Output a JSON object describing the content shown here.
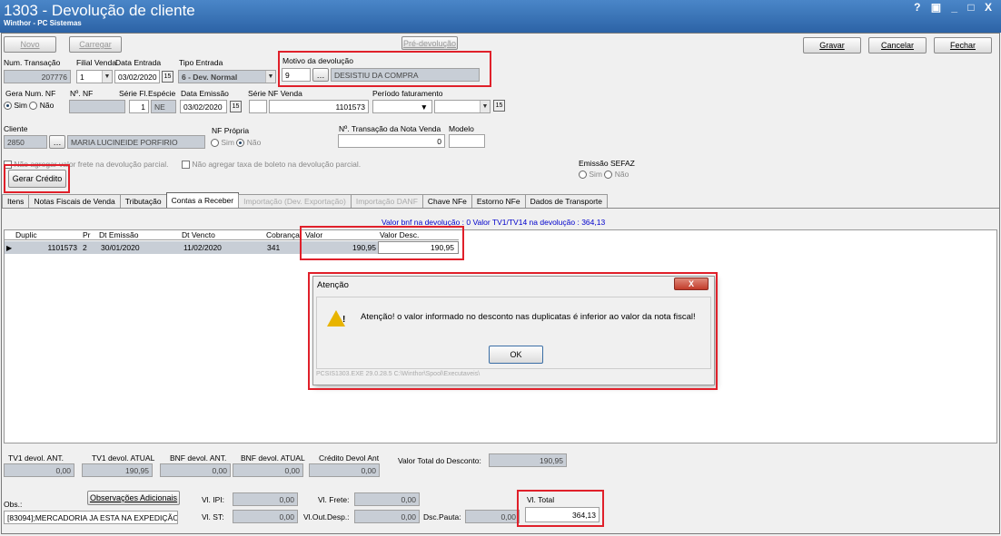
{
  "window": {
    "title": "1303 - Devolução de cliente",
    "subtitle": "Winthor - PC Sistemas",
    "controls": "? ▣ _ □ X"
  },
  "toolbar": {
    "novo": "Novo",
    "carregar": "Carregar",
    "pre_devolucao": "Pré-devolução",
    "gravar": "Gravar",
    "cancelar": "Cancelar",
    "fechar": "Fechar"
  },
  "header": {
    "num_transacao_label": "Num. Transação",
    "num_transacao": "207776",
    "filial_venda_label": "Filial Venda",
    "filial_venda": "1",
    "data_entrada_label": "Data Entrada",
    "data_entrada": "03/02/2020",
    "tipo_entrada_label": "Tipo Entrada",
    "tipo_entrada": "6 - Dev. Normal",
    "motivo_label": "Motivo da devolução",
    "motivo_codigo": "9",
    "motivo_desc": "DESISTIU DA COMPRA",
    "gera_num_nf_label": "Gera Num. NF",
    "sim": "Sim",
    "nao": "Não",
    "num_nf_label": "Nº. NF",
    "serie_fl_label": "Série Fl.",
    "serie_fl": "1",
    "especie_label": "Espécie",
    "especie": "NE",
    "data_emissao_label": "Data Emissão",
    "data_emissao": "03/02/2020",
    "serie_label": "Série",
    "nf_venda_label": "NF Venda",
    "nf_venda": "1101573",
    "periodo_label": "Período faturamento",
    "cliente_label": "Cliente",
    "cliente_codigo": "2850",
    "cliente_nome": "MARIA LUCINEIDE PORFIRIO",
    "nf_propria_label": "NF Própria",
    "num_transacao_nota_label": "Nº. Transação da Nota Venda",
    "num_transacao_nota": "0",
    "modelo_label": "Modelo",
    "frete_text": "Não agregar valor frete na devolução parcial.",
    "boleto_text": "Não agregar taxa de boleto na devolução parcial.",
    "sefaz_label": "Emissão SEFAZ",
    "gerar_credito": "Gerar Crédito"
  },
  "tabs": [
    "Itens",
    "Notas Fiscais de Venda",
    "Tributação",
    "Contas a Receber",
    "Importação (Dev. Exportação)",
    "Importação DANF",
    "Chave NFe",
    "Estorno NFe",
    "Dados de Transporte"
  ],
  "grid": {
    "info": "Valor bnf na devolução :  0  Valor TV1/TV14 na devolução :  364,13",
    "headers": {
      "duplic": "Duplic",
      "pr": "Pr",
      "dt_emissao": "Dt Emissão",
      "dt_vencto": "Dt Vencto",
      "cobranca": "Cobrança",
      "valor": "Valor",
      "valor_desc": "Valor Desc."
    },
    "row": {
      "duplic": "1101573",
      "pr": "2",
      "dt_emissao": "30/01/2020",
      "dt_vencto": "11/02/2020",
      "cobranca": "341",
      "valor": "190,95",
      "valor_desc": "190,95"
    }
  },
  "dialog": {
    "title": "Atenção",
    "message": "Atenção! o valor informado no desconto nas duplicatas é inferior ao valor da nota fiscal!",
    "ok": "OK",
    "footer": "PCSIS1303.EXE 29.0.28.5 C:\\Winthor\\Spool\\Executaveis\\",
    "close": "X"
  },
  "totals": {
    "tv1_ant_label": "TV1 devol. ANT.",
    "tv1_ant": "0,00",
    "tv1_atual_label": "TV1 devol. ATUAL",
    "tv1_atual": "190,95",
    "bnf_ant_label": "BNF devol. ANT.",
    "bnf_ant": "0,00",
    "bnf_atual_label": "BNF devol. ATUAL",
    "bnf_atual": "0,00",
    "credito_label": "Crédito Devol Ant",
    "credito": "0,00",
    "valor_total_desc_label": "Valor Total do Desconto:",
    "valor_total_desc": "190,95",
    "obs_label": "Obs.:",
    "obs_button": "Observações Adicionais",
    "obs_text": "[83094];MERCADORIA JA ESTA NA EXPEDIÇÃO;",
    "ipi_label": "Vl. IPI:",
    "ipi": "0,00",
    "st_label": "Vl. ST:",
    "st": "0,00",
    "frete_label": "Vl. Frete:",
    "frete": "0,00",
    "out_desp_label": "Vl.Out.Desp.:",
    "out_desp": "0,00",
    "dsc_pauta_label": "Dsc.Pauta:",
    "dsc_pauta": "0,00",
    "vl_total_label": "Vl. Total",
    "vl_total": "364,13"
  },
  "colors": {
    "highlight": "#e0202a",
    "titlebar": "#2c63a6",
    "link": "#0000cc"
  }
}
